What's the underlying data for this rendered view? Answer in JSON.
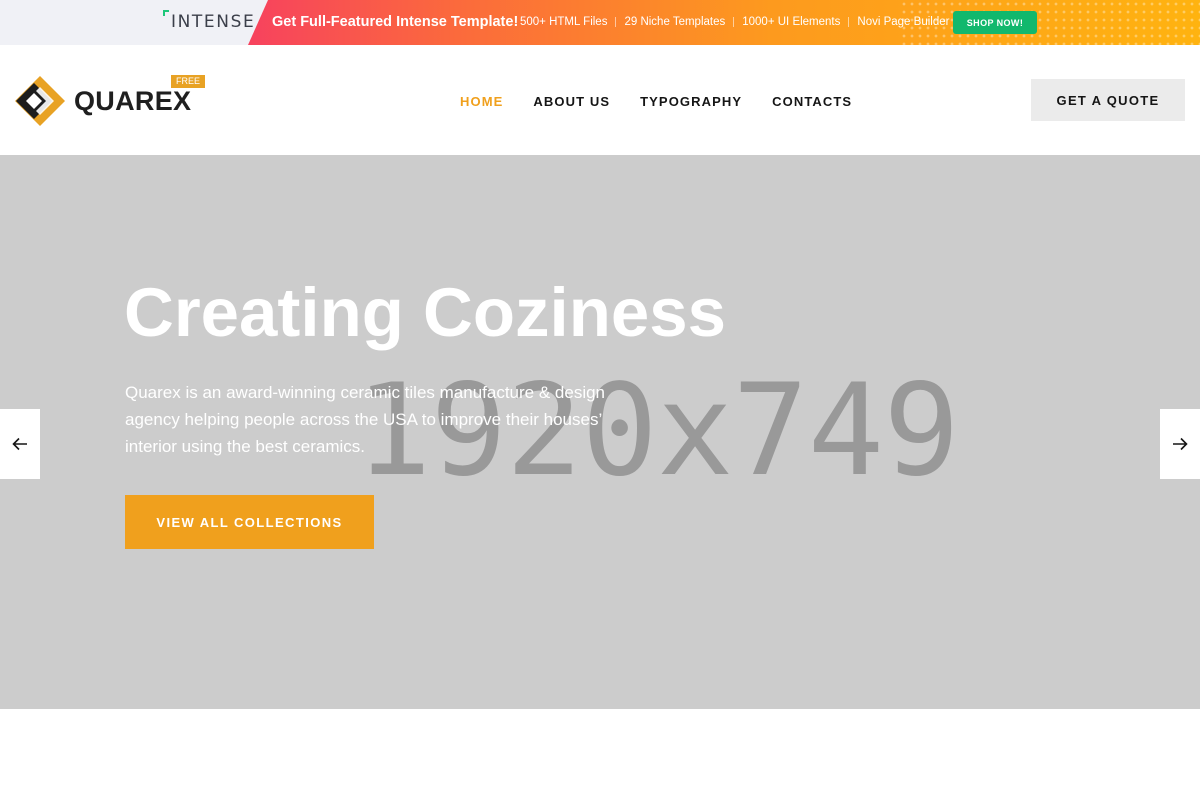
{
  "promo": {
    "brand": "INTENSE",
    "headline": "Get Full-Featured Intense Template!",
    "features": [
      "500+ HTML Files",
      "29 Niche Templates",
      "1000+ UI Elements",
      "Novi Page Builder"
    ],
    "cta_label": "SHOP NOW!"
  },
  "header": {
    "logo_text": "QUAREX",
    "logo_badge": "FREE",
    "nav": [
      {
        "label": "HOME",
        "active": true
      },
      {
        "label": "ABOUT US",
        "active": false
      },
      {
        "label": "TYPOGRAPHY",
        "active": false
      },
      {
        "label": "CONTACTS",
        "active": false
      }
    ],
    "quote_label": "GET A QUOTE"
  },
  "hero": {
    "placeholder_text": "1920x749",
    "title": "Creating Coziness",
    "text": "Quarex is an award-winning ceramic tiles manufacture & design agency helping people across the USA to improve their houses’ interior using the best ceramics.",
    "button_label": "VIEW ALL COLLECTIONS",
    "prev_icon": "arrow-left-icon",
    "next_icon": "arrow-right-icon"
  },
  "colors": {
    "accent": "#f0a01d",
    "shop_button": "#11b86d",
    "hero_background": "#cccccc",
    "promo_gradient_start": "#f7425e",
    "promo_gradient_end": "#ffb310"
  }
}
